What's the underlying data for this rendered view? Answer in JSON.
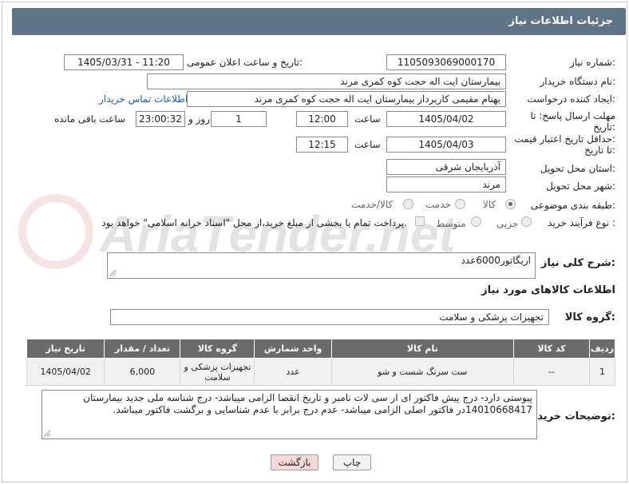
{
  "header": {
    "title": "جزئیات اطلاعات نیاز"
  },
  "form": {
    "need_number_label": "شماره نیاز:",
    "need_number": "1105093069000170",
    "announce_label": "تاریخ و ساعت اعلان عمومی:",
    "announce_value": "1405/03/31 - 11:20",
    "buyer_org_label": "نام دستگاه خریدار:",
    "buyer_org": "بیمارستان ایت اله حجت کوه کمری مرند",
    "creator_label": "ایجاد کننده درخواست:",
    "creator": "بهنام مقیمی کارپرداز بیمارستان ایت اله حجت کوه کمری مرند",
    "contact_link": "اطلاعات تماس خریدار",
    "deadline_label_1": "مهلت ارسال پاسخ: تا",
    "deadline_label_2": "تاریخ:",
    "deadline_date": "1405/04/02",
    "time_label": "ساعت",
    "deadline_time": "12:00",
    "days_value": "1",
    "days_label": "روز و",
    "remaining_time": "23:00:32",
    "remaining_label": "ساعت باقی مانده",
    "price_label_1": "حداقل تاریخ اعتبار قیمت:",
    "price_label_2": "تا تاریخ:",
    "price_date": "1405/04/03",
    "price_time": "12:15",
    "province_label": "استان محل تحویل:",
    "province": "آذربایجان شرقی",
    "city_label": "شهر محل تحویل:",
    "city": "مرند",
    "category_label": "طبقه بندی موضوعی:",
    "category_options": [
      "کالا",
      "خدمت",
      "کالا/خدمت"
    ],
    "process_label": "نوع فرآیند خرید :",
    "process_options": [
      "جزیی",
      "متوسط"
    ],
    "payment_note": "پرداخت تمام یا بخشی از مبلغ خرید،از محل \"اسناد خزانه اسلامی\" خواهد بود."
  },
  "summary": {
    "label": "شرح کلی نیاز:",
    "value": "اریگاتور6000عدد"
  },
  "goods": {
    "section_title": "اطلاعات کالاهای مورد نیاز",
    "group_label": "گروه کالا:",
    "group_value": "تجهیزات پزشکی و سلامت"
  },
  "table": {
    "headers": [
      "ردیف",
      "کد کالا",
      "نام کالا",
      "واحد شمارش",
      "گروه کالا",
      "تعداد / مقدار",
      "تاریخ نیاز"
    ],
    "rows": [
      {
        "row": "1",
        "code": "--",
        "name": "ست سرنگ شست و شو",
        "unit": "عدد",
        "group": "تجهیزات پزشکی و سلامت",
        "qty": "6,000",
        "date": "1405/04/02"
      }
    ]
  },
  "notes": {
    "label": "توضیحات خریدار:",
    "value": "پیوستی دارد- درج پیش فاکتور ای ار سی لات نامبر و تاریخ انقضا الزامی میباشد- درج شناسه ملی  جدید بیمارستان 14010668417در فاکتور اصلی الزامی میباشد- عدم درج برابر با عدم شناسایی و برگشت فاکتور میباشد."
  },
  "buttons": {
    "print": "چاپ",
    "back": "بازگشت"
  },
  "watermark": "AriaTender.net",
  "colors": {
    "header_bg": "#5f7487",
    "link": "#1f5aa8",
    "table_header_bg": "#6b6b6b",
    "back_button_bg": "#f6d8d8"
  }
}
